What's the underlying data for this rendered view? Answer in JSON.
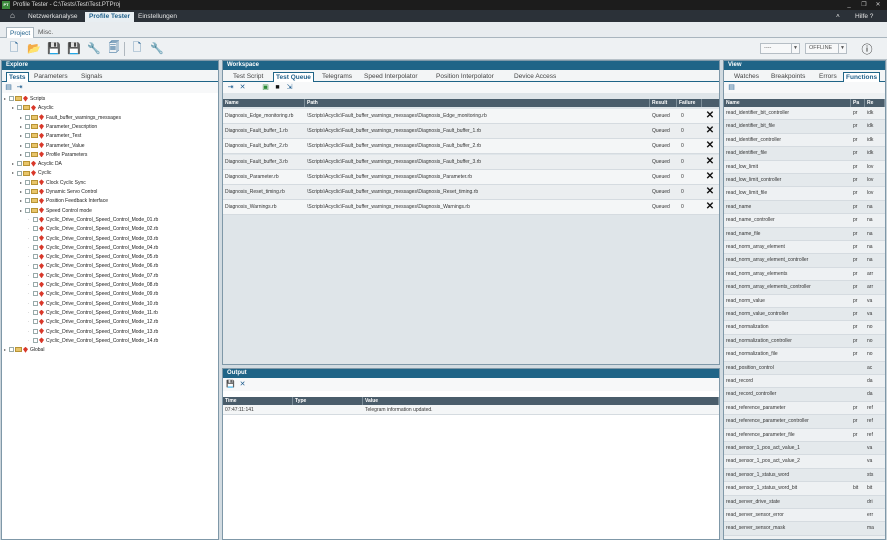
{
  "window": {
    "title": "Profile Tester - C:\\Tests\\Test\\Test.PTProj",
    "app_icon": "PT",
    "min": "_",
    "restore": "❐",
    "close": "✕"
  },
  "menubar": {
    "home": "⌂",
    "items": [
      "Netzwerkanalyse",
      "Profile Tester",
      "Einstellungen"
    ],
    "help": "Hilfe ?",
    "collapse": "˄"
  },
  "subtabs": [
    "Project",
    "Misc."
  ],
  "toolbar": {
    "combo1": "----",
    "combo2": "OFFLINE",
    "info": "ⓘ"
  },
  "explore": {
    "header": "Explore",
    "tabs": [
      "Tests",
      "Parameters",
      "Signals"
    ],
    "tree": [
      {
        "label": "Scripts",
        "level": 0
      },
      {
        "label": "Acyclic",
        "level": 1
      },
      {
        "label": "Fault_buffer_warnings_messages",
        "level": 2
      },
      {
        "label": "Parameter_Description",
        "level": 2
      },
      {
        "label": "Parameter_Test",
        "level": 2
      },
      {
        "label": "Parameter_Value",
        "level": 2
      },
      {
        "label": "Profile Parameters",
        "level": 2
      },
      {
        "label": "Acyclic DA",
        "level": 1
      },
      {
        "label": "Cyclic",
        "level": 1
      },
      {
        "label": "Clock Cyclic Sync",
        "level": 2
      },
      {
        "label": "Dynamic Servo Control",
        "level": 2
      },
      {
        "label": "Position Feedback Interface",
        "level": 2
      },
      {
        "label": "Speed Control mode",
        "level": 2
      },
      {
        "label": "Cyclic_Drive_Control_Speed_Control_Mode_01.rb",
        "level": 3
      },
      {
        "label": "Cyclic_Drive_Control_Speed_Control_Mode_02.rb",
        "level": 3
      },
      {
        "label": "Cyclic_Drive_Control_Speed_Control_Mode_03.rb",
        "level": 3
      },
      {
        "label": "Cyclic_Drive_Control_Speed_Control_Mode_04.rb",
        "level": 3
      },
      {
        "label": "Cyclic_Drive_Control_Speed_Control_Mode_05.rb",
        "level": 3
      },
      {
        "label": "Cyclic_Drive_Control_Speed_Control_Mode_06.rb",
        "level": 3
      },
      {
        "label": "Cyclic_Drive_Control_Speed_Control_Mode_07.rb",
        "level": 3
      },
      {
        "label": "Cyclic_Drive_Control_Speed_Control_Mode_08.rb",
        "level": 3
      },
      {
        "label": "Cyclic_Drive_Control_Speed_Control_Mode_09.rb",
        "level": 3
      },
      {
        "label": "Cyclic_Drive_Control_Speed_Control_Mode_10.rb",
        "level": 3
      },
      {
        "label": "Cyclic_Drive_Control_Speed_Control_Mode_11.rb",
        "level": 3
      },
      {
        "label": "Cyclic_Drive_Control_Speed_Control_Mode_12.rb",
        "level": 3
      },
      {
        "label": "Cyclic_Drive_Control_Speed_Control_Mode_13.rb",
        "level": 3
      },
      {
        "label": "Cyclic_Drive_Control_Speed_Control_Mode_14.rb",
        "level": 3
      },
      {
        "label": "Global",
        "level": 0
      }
    ]
  },
  "workspace": {
    "header": "Workspace",
    "tabs": [
      "Test Script",
      "Test Queue",
      "Telegrams",
      "Speed Interpolator",
      "Position Interpolator",
      "Device Access"
    ],
    "columns": [
      "Name",
      "Path",
      "Result",
      "Failure"
    ],
    "rows": [
      {
        "name": "Diagnosis_Edge_monitoring.rb",
        "path": "\\Scripts\\Acyclic\\Fault_buffer_warnings_messages\\Diagnosis_Edge_monitoring.rb",
        "result": "Queued",
        "failure": "0"
      },
      {
        "name": "Diagnosis_Fault_buffer_1.rb",
        "path": "\\Scripts\\Acyclic\\Fault_buffer_warnings_messages\\Diagnosis_Fault_buffer_1.rb",
        "result": "Queued",
        "failure": "0"
      },
      {
        "name": "Diagnosis_Fault_buffer_2.rb",
        "path": "\\Scripts\\Acyclic\\Fault_buffer_warnings_messages\\Diagnosis_Fault_buffer_2.rb",
        "result": "Queued",
        "failure": "0"
      },
      {
        "name": "Diagnosis_Fault_buffer_3.rb",
        "path": "\\Scripts\\Acyclic\\Fault_buffer_warnings_messages\\Diagnosis_Fault_buffer_3.rb",
        "result": "Queued",
        "failure": "0"
      },
      {
        "name": "Diagnosis_Parameter.rb",
        "path": "\\Scripts\\Acyclic\\Fault_buffer_warnings_messages\\Diagnosis_Parameter.rb",
        "result": "Queued",
        "failure": "0"
      },
      {
        "name": "Diagnosis_Reset_timing.rb",
        "path": "\\Scripts\\Acyclic\\Fault_buffer_warnings_messages\\Diagnosis_Reset_timing.rb",
        "result": "Queued",
        "failure": "0"
      },
      {
        "name": "Diagnosis_Warnings.rb",
        "path": "\\Scripts\\Acyclic\\Fault_buffer_warnings_messages\\Diagnosis_Warnings.rb",
        "result": "Queued",
        "failure": "0"
      }
    ]
  },
  "output": {
    "header": "Output",
    "columns": [
      "Time",
      "Type",
      "Value"
    ],
    "rows": [
      {
        "time": "07:47:11:141",
        "type": "",
        "value": "Telegram information updated."
      }
    ]
  },
  "view": {
    "header": "View",
    "tabs": [
      "Watches",
      "Breakpoints",
      "Errors",
      "Functions"
    ],
    "columns": [
      "Name",
      "Pa",
      "Re"
    ],
    "rows": [
      {
        "name": "read_identifier_bit_controller",
        "pa": "pr",
        "re": "idk"
      },
      {
        "name": "read_identifier_bit_file",
        "pa": "pr",
        "re": "idk"
      },
      {
        "name": "read_identifier_controller",
        "pa": "pr",
        "re": "idk"
      },
      {
        "name": "read_identifier_file",
        "pa": "pr",
        "re": "idk"
      },
      {
        "name": "read_low_limit",
        "pa": "pr",
        "re": "lov"
      },
      {
        "name": "read_low_limit_controller",
        "pa": "pr",
        "re": "lov"
      },
      {
        "name": "read_low_limit_file",
        "pa": "pr",
        "re": "lov"
      },
      {
        "name": "read_name",
        "pa": "pr",
        "re": "na"
      },
      {
        "name": "read_name_controller",
        "pa": "pr",
        "re": "na"
      },
      {
        "name": "read_name_file",
        "pa": "pr",
        "re": "na"
      },
      {
        "name": "read_norm_array_element",
        "pa": "pr",
        "re": "na"
      },
      {
        "name": "read_norm_array_element_controller",
        "pa": "pr",
        "re": "na"
      },
      {
        "name": "read_norm_array_elements",
        "pa": "pr",
        "re": "arr"
      },
      {
        "name": "read_norm_array_elements_controller",
        "pa": "pr",
        "re": "arr"
      },
      {
        "name": "read_norm_value",
        "pa": "pr",
        "re": "va"
      },
      {
        "name": "read_norm_value_controller",
        "pa": "pr",
        "re": "va"
      },
      {
        "name": "read_normalization",
        "pa": "pr",
        "re": "no"
      },
      {
        "name": "read_normalization_controller",
        "pa": "pr",
        "re": "no"
      },
      {
        "name": "read_normalization_file",
        "pa": "pr",
        "re": "no"
      },
      {
        "name": "read_position_control",
        "pa": "",
        "re": "ac"
      },
      {
        "name": "read_record",
        "pa": "",
        "re": "da"
      },
      {
        "name": "read_record_controller",
        "pa": "",
        "re": "da"
      },
      {
        "name": "read_reference_parameter",
        "pa": "pr",
        "re": "ref"
      },
      {
        "name": "read_reference_parameter_controller",
        "pa": "pr",
        "re": "ref"
      },
      {
        "name": "read_reference_parameter_file",
        "pa": "pr",
        "re": "ref"
      },
      {
        "name": "read_sensor_1_pos_act_value_1",
        "pa": "",
        "re": "va"
      },
      {
        "name": "read_sensor_1_pos_act_value_2",
        "pa": "",
        "re": "va"
      },
      {
        "name": "read_sensor_1_status_word",
        "pa": "",
        "re": "sts"
      },
      {
        "name": "read_sensor_1_status_word_bit",
        "pa": "bit",
        "re": "bit"
      },
      {
        "name": "read_server_drive_state",
        "pa": "",
        "re": "dri"
      },
      {
        "name": "read_server_sensor_error",
        "pa": "",
        "re": "err"
      },
      {
        "name": "read_server_sensor_mask",
        "pa": "",
        "re": "ma"
      }
    ]
  }
}
